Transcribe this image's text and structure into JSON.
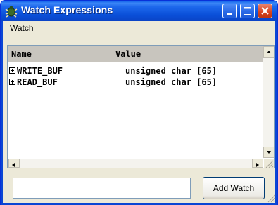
{
  "window": {
    "title": "Watch Expressions"
  },
  "menu": {
    "watch_label": "Watch"
  },
  "table": {
    "columns": {
      "name": "Name",
      "value": "Value"
    },
    "rows": [
      {
        "name": "WRITE_BUF",
        "value": "unsigned char [65]"
      },
      {
        "name": "READ_BUF",
        "value": "unsigned char [65]"
      }
    ]
  },
  "input": {
    "value": ""
  },
  "buttons": {
    "add_watch": "Add Watch"
  },
  "colors": {
    "titlebar": "#0a5ce8",
    "close": "#d6431e",
    "face": "#ece9d8",
    "header": "#c8c5be"
  }
}
